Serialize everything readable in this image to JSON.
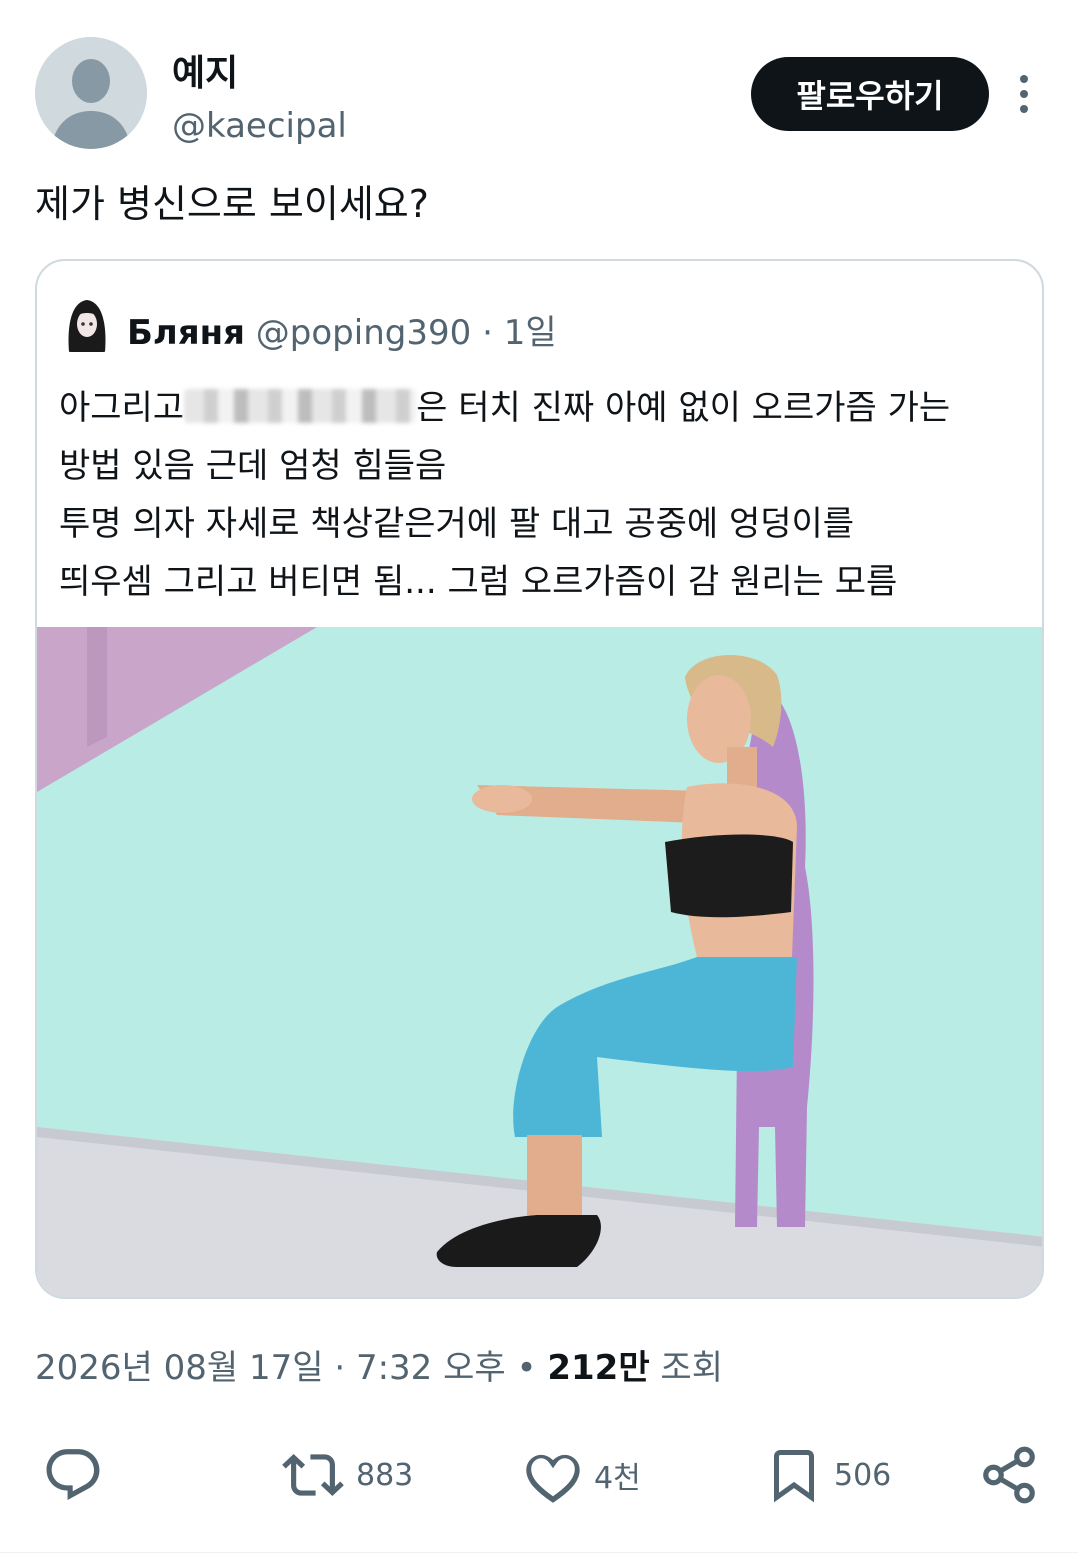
{
  "author": {
    "display_name": "예지",
    "handle": "@kaecipal"
  },
  "follow_label": "팔로우하기",
  "tweet_text": "제가 병신으로 보이세요?",
  "quote": {
    "display_name": "Бляня",
    "handle": "@poping390",
    "dot": "·",
    "time": "1일",
    "lines": {
      "l1_before": "아그리고",
      "l1_after": "은 터치 진짜 아예 없이 오르가즘 가는",
      "l2": "방법 있음 근데 엄청 힘들음",
      "l3": "투명 의자 자세로 책상같은거에 팔 대고 공중에 엉덩이를",
      "l4": "띄우셈 그리고 버티면 됨... 그럼 오르가즘이 감 원리는 모름"
    }
  },
  "meta": {
    "date": "2026년 08월 17일",
    "sep": " · ",
    "time": "7:32 오후",
    "bullet": " • ",
    "views_num": "212만",
    "views_label": " 조회"
  },
  "actions": {
    "reply": {
      "icon": "reply-icon",
      "count": ""
    },
    "retweet": {
      "icon": "retweet-icon",
      "count": "883"
    },
    "like": {
      "icon": "heart-icon",
      "count": "4천"
    },
    "bookmark": {
      "icon": "bookmark-icon",
      "count": "506"
    },
    "share": {
      "icon": "share-icon",
      "count": ""
    }
  },
  "colors": {
    "text_primary": "#0f1419",
    "text_secondary": "#536471",
    "follow_bg": "#0f1419",
    "card_border": "#cfd9de",
    "photo_wall": "#b8ece4",
    "photo_shadow": "#b58acb",
    "leggings": "#4db6d6"
  }
}
